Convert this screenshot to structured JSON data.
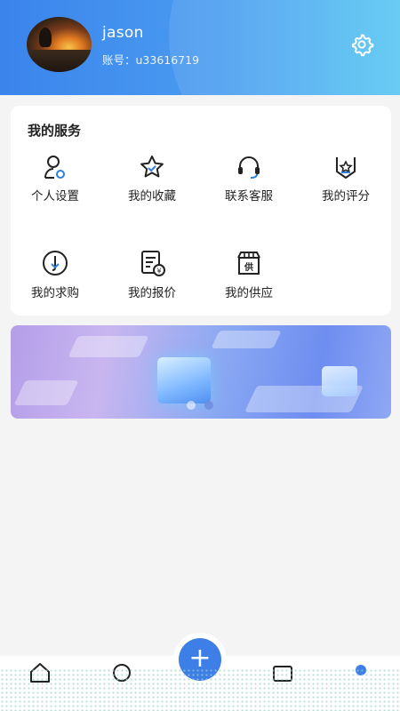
{
  "profile": {
    "username": "jason",
    "account": "账号：u33616719"
  },
  "services": {
    "title": "我的服务",
    "items": [
      {
        "label": "个人设置",
        "icon": "person-settings-icon"
      },
      {
        "label": "我的收藏",
        "icon": "star-icon"
      },
      {
        "label": "联系客服",
        "icon": "headset-icon"
      },
      {
        "label": "我的评分",
        "icon": "rating-badge-icon"
      },
      {
        "label": "我的求购",
        "icon": "purchase-request-icon"
      },
      {
        "label": "我的报价",
        "icon": "quotation-icon"
      },
      {
        "label": "我的供应",
        "icon": "supply-store-icon"
      }
    ]
  },
  "banner": {
    "slides": 2,
    "active_slide": 2
  },
  "tabbar": {
    "fab": "+",
    "icons": [
      "home-icon",
      "message-icon",
      "add-icon",
      "photo-icon",
      "profile-icon"
    ]
  },
  "colors": {
    "accent": "#3d7fe6",
    "header_start": "#3a84ec",
    "header_end": "#57c7f2"
  }
}
